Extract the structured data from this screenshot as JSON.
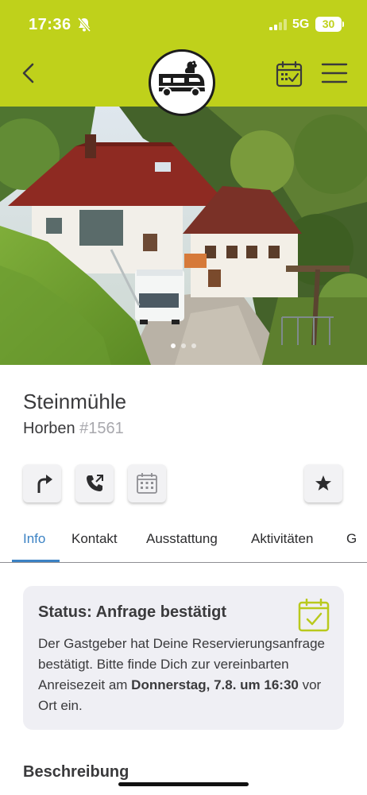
{
  "status_bar": {
    "time": "17:36",
    "network": "5G",
    "battery": "30"
  },
  "header": {
    "back_icon": "chevron-left-icon",
    "logo_icon": "camper-van-logo",
    "calendar_icon": "calendar-check-icon",
    "menu_icon": "hamburger-menu-icon",
    "accent_color": "#bfd11b"
  },
  "gallery": {
    "photo_description_icon": "photo",
    "dot_count": 3,
    "active_dot": 1
  },
  "place": {
    "name": "Steinmühle",
    "town": "Horben",
    "id": "#1561"
  },
  "actions": [
    {
      "icon": "directions-icon"
    },
    {
      "icon": "phone-icon"
    },
    {
      "icon": "calendar-icon"
    },
    {
      "icon": "star-icon"
    }
  ],
  "tabs": [
    {
      "label": "Info",
      "active": true
    },
    {
      "label": "Kontakt"
    },
    {
      "label": "Ausstattung"
    },
    {
      "label": "Aktivitäten"
    },
    {
      "label": "G"
    }
  ],
  "status_card": {
    "title": "Status: Anfrage bestätigt",
    "text_before": "Der Gastgeber hat Deine Reservierungsanfrage bestätigt. Bitte finde Dich zur vereinbarten Anreisezeit am ",
    "text_bold": "Donnerstag, 7.8. um 16:30",
    "text_after": " vor Ort ein.",
    "icon": "calendar-check-icon",
    "icon_color": "#b9c91d"
  },
  "section_title": "Beschreibung",
  "colors": {
    "tab_active": "#3b82c4",
    "card_bg": "#efeff4"
  }
}
